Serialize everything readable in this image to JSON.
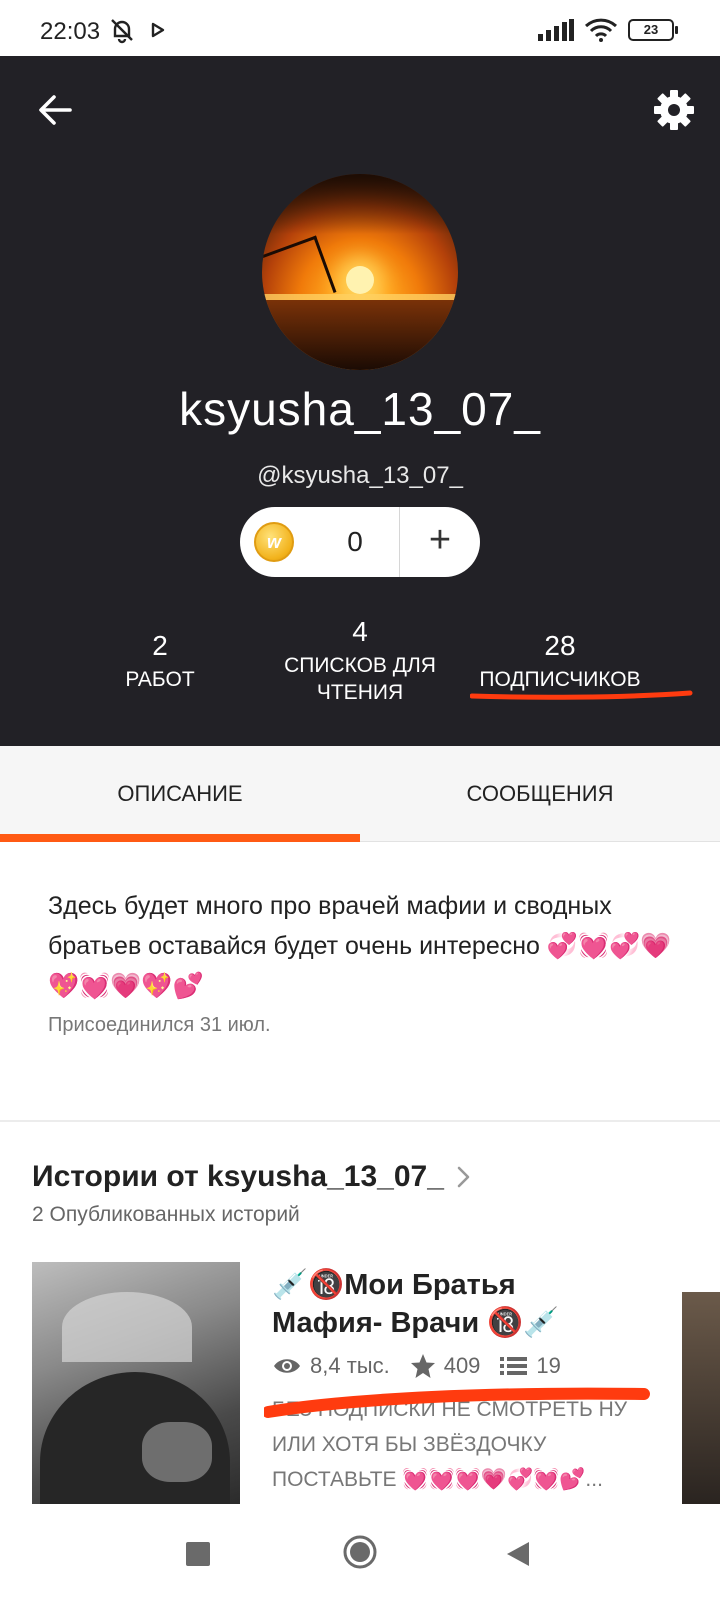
{
  "status_bar": {
    "time": "22:03",
    "battery": "23",
    "icons": [
      "bell-off-icon",
      "play-icon",
      "signal-icon",
      "wifi-icon",
      "battery-icon"
    ]
  },
  "header": {
    "back_icon": "arrow-left-icon",
    "settings_icon": "gear-icon",
    "display_name": "ksyusha_13_07_",
    "username": "@ksyusha_13_07_",
    "coins": {
      "coin_letter": "w",
      "count": "0",
      "add_label": "+"
    },
    "stats": {
      "works": {
        "value": "2",
        "label": "РАБОТ"
      },
      "reading_lists": {
        "value": "4",
        "label": "СПИСКОВ ДЛЯ ЧТЕНИЯ"
      },
      "followers": {
        "value": "28",
        "label": "ПОДПИСЧИКОВ"
      }
    },
    "colors": {
      "background": "#222126",
      "annotation": "#ff3b0f"
    }
  },
  "tabs": [
    {
      "label": "ОПИСАНИЕ",
      "active": true
    },
    {
      "label": "СООБЩЕНИЯ",
      "active": false
    }
  ],
  "accent_color": "#ff5a14",
  "about": {
    "text": "Здесь будет много про врачей мафии и сводных братьев оставайся будет очень интересно 💞💓💞💗💖💓💗💖💕",
    "joined": "Присоединился 31 июл."
  },
  "stories": {
    "title": "Истории от ksyusha_13_07_",
    "subtitle": "2 Опубликованных историй",
    "items": [
      {
        "title": "💉🔞Мои Братья Мафия- Врачи 🔞💉",
        "views": "8,4 тыс.",
        "votes": "409",
        "parts": "19",
        "description": "БЕЗ ПОДПИСКИ НЕ СМОТРЕТЬ НУ ИЛИ ХОТЯ БЫ ЗВЁЗДОЧКУ ПОСТАВЬТЕ 💓💓💓💗💞💓💕..."
      }
    ]
  },
  "nav": {
    "recent_icon": "square-icon",
    "home_icon": "circle-home-icon",
    "back_icon": "triangle-back-icon"
  }
}
